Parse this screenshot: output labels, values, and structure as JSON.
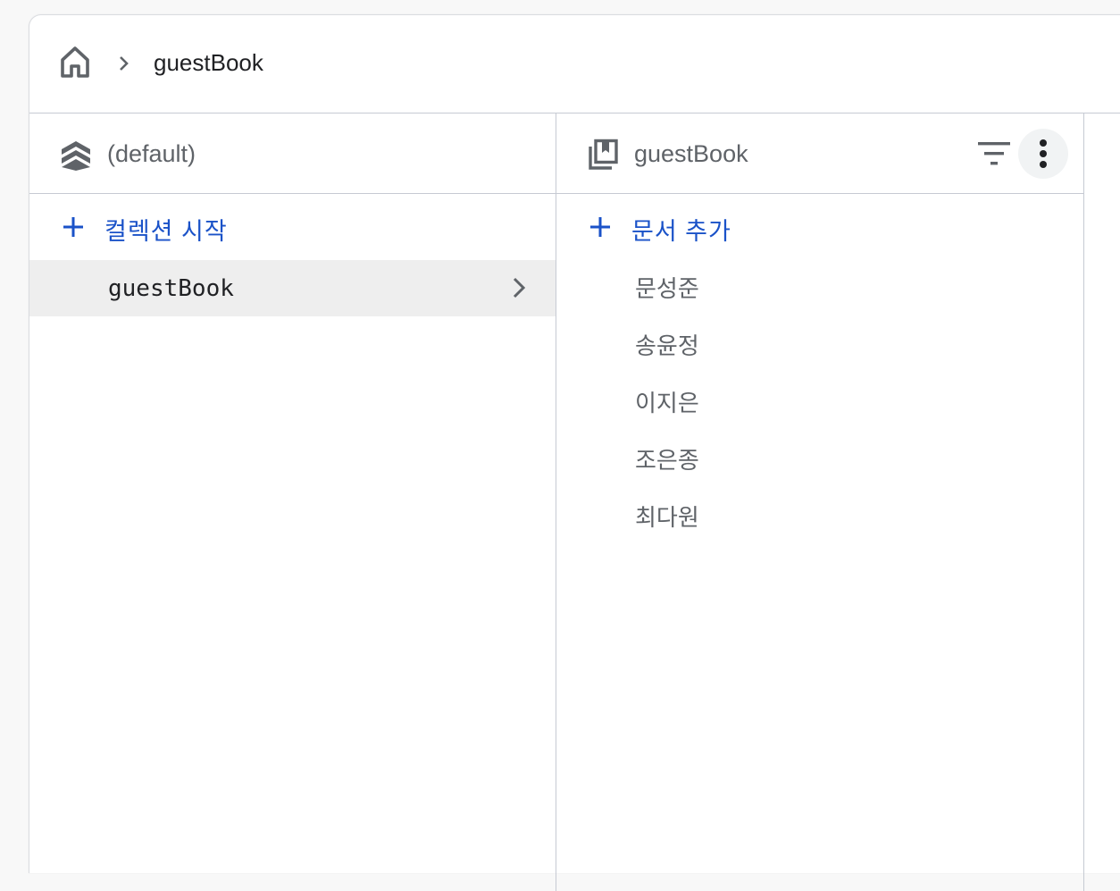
{
  "breadcrumb": {
    "home_icon": "home-icon",
    "separator_icon": "chevron-right-icon",
    "current": "guestBook"
  },
  "database_column": {
    "icon": "firestore-database-icon",
    "title": "(default)",
    "add_label": "컬렉션 시작",
    "collections": [
      {
        "name": "guestBook",
        "selected": true
      }
    ]
  },
  "collection_column": {
    "icon": "collection-icon",
    "title": "guestBook",
    "filter_icon": "filter-icon",
    "more_icon": "more-vert-icon",
    "add_label": "문서 추가",
    "documents": [
      "문성준",
      "송윤정",
      "이지은",
      "조은종",
      "최다원"
    ]
  },
  "colors": {
    "accent": "#1a52c8",
    "selected_row": "#eeeeee",
    "text_secondary": "#5f6368",
    "border": "#c6cad3"
  }
}
